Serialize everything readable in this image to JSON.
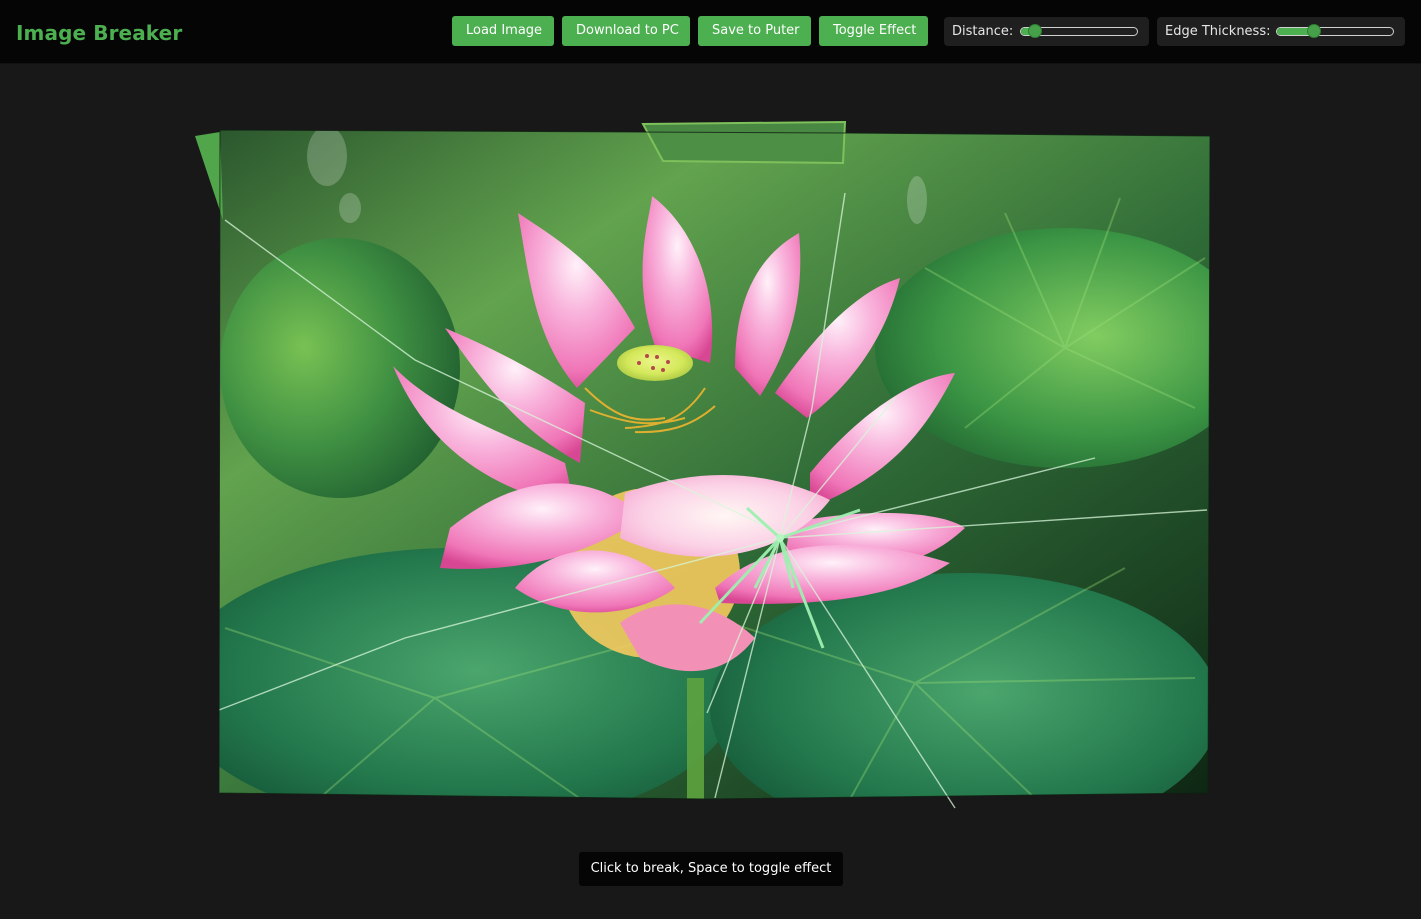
{
  "app": {
    "title": "Image Breaker"
  },
  "toolbar": {
    "load_label": "Load Image",
    "download_label": "Download to PC",
    "save_puter_label": "Save to Puter",
    "toggle_effect_label": "Toggle Effect"
  },
  "controls": {
    "distance": {
      "label": "Distance:",
      "value_percent": 12
    },
    "edge_thickness": {
      "label": "Edge Thickness:",
      "value_percent": 32
    }
  },
  "canvas": {
    "impact_label": "impact",
    "accent_color": "#4caf50",
    "background_color": "#181818"
  },
  "status": {
    "hint": "Click to break, Space to toggle effect"
  }
}
